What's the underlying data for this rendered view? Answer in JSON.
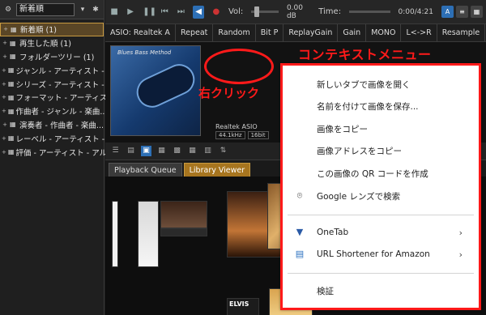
{
  "left_panel": {
    "combo_label": "新着順",
    "items": [
      {
        "label": "新着順 (1)",
        "selected": true
      },
      {
        "label": "再生した順 (1)"
      },
      {
        "label": "フォルダーツリー (1)"
      },
      {
        "label": "ジャンル - アーティスト - ..."
      },
      {
        "label": "シリーズ - アーティスト - ..."
      },
      {
        "label": "フォーマット - アーティスト - ..."
      },
      {
        "label": "作曲者 - ジャンル - 楽曲..."
      },
      {
        "label": "演奏者 - 作曲者 - 楽曲..."
      },
      {
        "label": "レーベル - アーティスト - ..."
      },
      {
        "label": "評価 - アーティスト - アル..."
      }
    ]
  },
  "toolbar1": {
    "vol_label": "Vol:",
    "vol_value": "0.00 dB",
    "time_label": "Time:",
    "time_value": "0:00/4:21"
  },
  "toolbar2": {
    "cells": [
      "ASIO: Realtek A",
      "Repeat",
      "Random",
      "Bit P",
      "ReplayGain",
      "Gain",
      "MONO",
      "L<->R",
      "Resample",
      "VS"
    ]
  },
  "now_playing": {
    "album_title": "Blues Bass Method",
    "device": "Realtek ASIO",
    "freq": "44.1kHz",
    "bits": "16bit"
  },
  "tabs": {
    "playback_queue": "Playback Queue",
    "library_viewer": "Library Viewer"
  },
  "library": {
    "elvis_label": "ELVIS"
  },
  "annotations": {
    "context_menu_title": "コンテキストメニュー",
    "right_click": "右クリック"
  },
  "context_menu": {
    "items": [
      {
        "label": "新しいタブで画像を開く"
      },
      {
        "label": "名前を付けて画像を保存..."
      },
      {
        "label": "画像をコピー"
      },
      {
        "label": "画像アドレスをコピー"
      },
      {
        "label": "この画像の QR コードを作成"
      },
      {
        "label": "Google レンズで検索",
        "icon": "google-lens-icon"
      },
      {
        "label": "OneTab",
        "icon": "onetab-icon",
        "submenu": true
      },
      {
        "label": "URL Shortener for Amazon",
        "icon": "url-shortener-icon",
        "submenu": true
      },
      {
        "label": "検証"
      }
    ]
  }
}
